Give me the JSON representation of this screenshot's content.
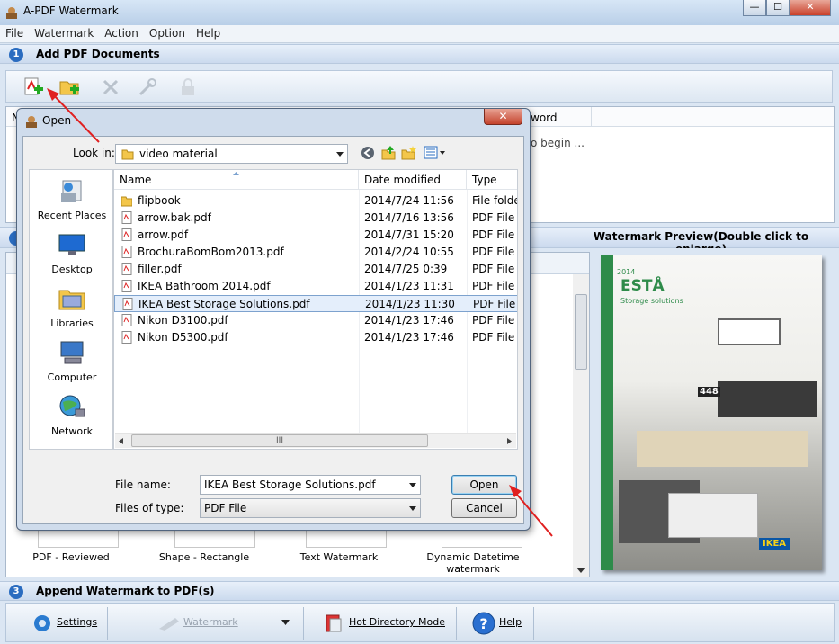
{
  "app": {
    "title": "A-PDF Watermark",
    "caption_min": "—",
    "caption_max": "☐",
    "caption_close": "✕"
  },
  "menu": [
    "File",
    "Watermark",
    "Action",
    "Option",
    "Help"
  ],
  "steps": {
    "step1": {
      "num": "1",
      "label": "Add PDF Documents"
    },
    "step3": {
      "num": "3",
      "label": "Append Watermark to PDF(s)"
    }
  },
  "list_panel": {
    "col_fragment_left": "N",
    "col_fragment_right": "word",
    "hint": "o begin ..."
  },
  "preview": {
    "title": "Watermark Preview(Double click to enlarge)",
    "cover_brand": "IKEA",
    "cover_word": "ESTÅ",
    "cover_sub": "Storage solutions",
    "cover_year": "2014",
    "cover_price": "448"
  },
  "templates": [
    {
      "label": "PDF - Reviewed"
    },
    {
      "label": "Shape - Rectangle"
    },
    {
      "label": "Text Watermark"
    },
    {
      "label": "Dynamic Datetime watermark"
    }
  ],
  "bottom": {
    "settings": "Settings",
    "watermark": "Watermark",
    "hot_dir": "Hot Directory Mode",
    "help": "Help"
  },
  "dialog": {
    "title": "Open",
    "close": "✕",
    "look_in_label": "Look in:",
    "look_in_value": "video material",
    "places": [
      "Recent Places",
      "Desktop",
      "Libraries",
      "Computer",
      "Network"
    ],
    "columns": [
      "Name",
      "Date modified",
      "Type"
    ],
    "files": [
      {
        "name": "flipbook",
        "date": "2014/7/24 11:56",
        "type": "File folder",
        "kind": "folder"
      },
      {
        "name": "arrow.bak.pdf",
        "date": "2014/7/16 13:56",
        "type": "PDF File",
        "kind": "pdf"
      },
      {
        "name": "arrow.pdf",
        "date": "2014/7/31 15:20",
        "type": "PDF File",
        "kind": "pdf"
      },
      {
        "name": "BrochuraBomBom2013.pdf",
        "date": "2014/2/24 10:55",
        "type": "PDF File",
        "kind": "pdf"
      },
      {
        "name": "filler.pdf",
        "date": "2014/7/25 0:39",
        "type": "PDF File",
        "kind": "pdf"
      },
      {
        "name": "IKEA Bathroom 2014.pdf",
        "date": "2014/1/23 11:31",
        "type": "PDF File",
        "kind": "pdf"
      },
      {
        "name": "IKEA Best Storage Solutions.pdf",
        "date": "2014/1/23 11:30",
        "type": "PDF File",
        "kind": "pdf",
        "selected": true
      },
      {
        "name": "Nikon D3100.pdf",
        "date": "2014/1/23 17:46",
        "type": "PDF File",
        "kind": "pdf"
      },
      {
        "name": "Nikon D5300.pdf",
        "date": "2014/1/23 17:46",
        "type": "PDF File",
        "kind": "pdf"
      }
    ],
    "file_name_label": "File name:",
    "file_name_value": "IKEA Best Storage Solutions.pdf",
    "file_type_label": "Files of type:",
    "file_type_value": "PDF File",
    "open_btn": "Open",
    "cancel_btn": "Cancel",
    "scroll_thumb": "III"
  },
  "colors": {
    "accent": "#2a6cc0",
    "arrow": "#e02020",
    "ikea_green": "#2e8b4a"
  }
}
